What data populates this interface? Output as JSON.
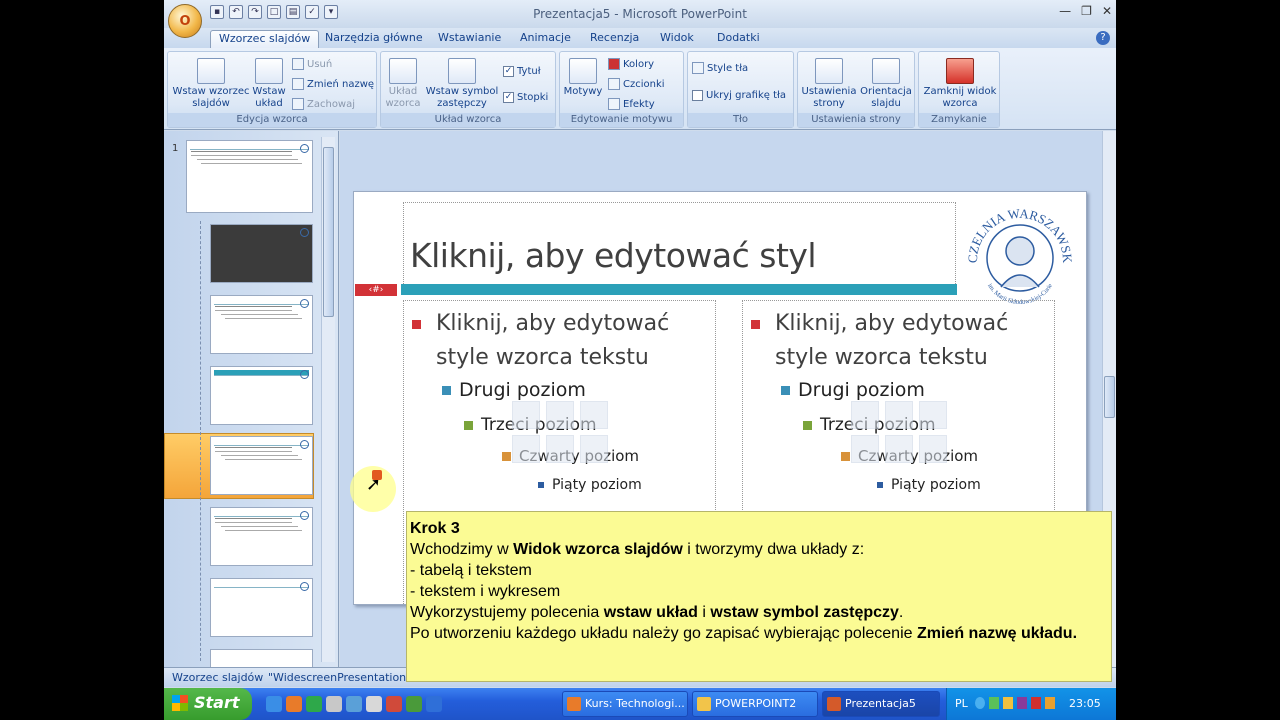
{
  "window": {
    "title": "Prezentacja5 - Microsoft PowerPoint",
    "office_label": "O"
  },
  "tabs": [
    {
      "label": "Wzorzec slajdów",
      "active": true
    },
    {
      "label": "Narzędzia główne"
    },
    {
      "label": "Wstawianie"
    },
    {
      "label": "Animacje"
    },
    {
      "label": "Recenzja"
    },
    {
      "label": "Widok"
    },
    {
      "label": "Dodatki"
    }
  ],
  "ribbon": {
    "groups": {
      "edycja": {
        "title": "Edycja wzorca",
        "insert_master": "Wstaw wzorzec slajdów",
        "insert_layout": "Wstaw układ",
        "delete": "Usuń",
        "rename": "Zmień nazwę",
        "preserve": "Zachowaj"
      },
      "uklad": {
        "title": "Układ wzorca",
        "layout_master": "Układ wzorca",
        "insert_placeholder": "Wstaw symbol zastępczy",
        "title_chk": "Tytuł",
        "footers_chk": "Stopki"
      },
      "motyw": {
        "title": "Edytowanie motywu",
        "themes": "Motywy",
        "colors": "Kolory",
        "fonts": "Czcionki",
        "effects": "Efekty"
      },
      "tlo": {
        "title": "Tło",
        "bg_styles": "Style tła",
        "hide_bg": "Ukryj grafikę tła"
      },
      "strona": {
        "title": "Ustawienia strony",
        "page_setup": "Ustawienia strony",
        "orientation": "Orientacja slajdu"
      },
      "zamykanie": {
        "title": "Zamykanie",
        "close_view": "Zamknij widok wzorca"
      }
    }
  },
  "thumbnails": {
    "first_number": "1"
  },
  "slide": {
    "title": "Kliknij, aby edytować styl",
    "number_tag": "‹#›",
    "left": {
      "l1": "Kliknij, aby edytować style wzorca tekstu",
      "l2": "Drugi poziom",
      "l3": "Trzeci poziom",
      "l4": "Czwarty poziom",
      "l5": "Piąty poziom"
    },
    "right": {
      "l1": "Kliknij, aby edytować style wzorca tekstu",
      "l2": "Drugi poziom",
      "l3": "Trzeci poziom",
      "l4": "Czwarty poziom",
      "l5": "Piąty poziom"
    },
    "logo": {
      "top": "UCZELNIA WARSZAWSKA",
      "bottom": "im. Marii Skłodowskiej-Curie"
    }
  },
  "caption": {
    "heading": "Krok 3",
    "line1_a": "Wchodzimy w ",
    "line1_b": "Widok wzorca slajdów",
    "line1_c": " i tworzymy dwa układy z:",
    "line2": "- tabelą i tekstem",
    "line3": "- tekstem i wykresem",
    "line4_a": "Wykorzystujemy polecenia ",
    "line4_b": "wstaw układ",
    "line4_c": " i ",
    "line4_d": "wstaw symbol zastępczy",
    "line4_e": ".",
    "line5_a": "Po utworzeniu każdego układu należy go zapisać wybierając polecenie ",
    "line5_b": "Zmień nazwę układu."
  },
  "status": {
    "view": "Wzorzec slajdów",
    "theme": "\"WidescreenPresentation\""
  },
  "taskbar": {
    "start": "Start",
    "tasks": [
      "Kurs: Technologi...",
      "POWERPOINT2",
      "Prezentacja5"
    ],
    "lang": "PL",
    "clock": "23:05"
  },
  "colors": {
    "accent_teal": "#2ba0b8",
    "slide_red": "#d23237",
    "caption_bg": "#fbfb94"
  }
}
